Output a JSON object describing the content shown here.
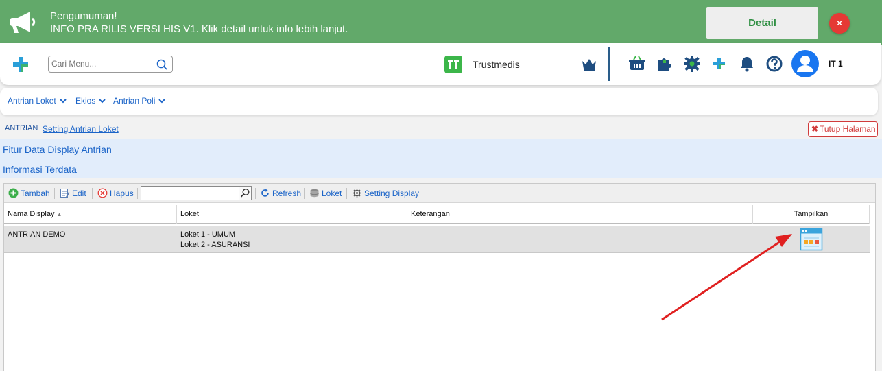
{
  "announcement": {
    "title": "Pengumuman!",
    "message": "INFO PRA RILIS VERSI HIS V1. Klik detail untuk info lebih lanjut.",
    "detail_label": "Detail",
    "close_label": "×",
    "icon": "megaphone-icon"
  },
  "header": {
    "search_placeholder": "Cari Menu...",
    "brand": "Trustmedis",
    "username": "IT 1",
    "icons": [
      "crown-icon",
      "basket-icon",
      "puzzle-icon",
      "gear-icon",
      "plus-icon",
      "bell-icon",
      "help-icon",
      "user-avatar-icon"
    ]
  },
  "menu": {
    "items": [
      {
        "label": "Antrian Loket"
      },
      {
        "label": "Ekios"
      },
      {
        "label": "Antrian Poli"
      }
    ]
  },
  "breadcrumb": {
    "root": "ANTRIAN",
    "active": "Setting Antrian Loket",
    "close_page": "Tutup Halaman"
  },
  "panels": {
    "line1": "Fitur Data Display Antrian",
    "line2": "Informasi Terdata"
  },
  "toolbar": {
    "add": "Tambah",
    "edit": "Edit",
    "delete": "Hapus",
    "search_value": "",
    "refresh": "Refresh",
    "loket": "Loket",
    "setting_display": "Setting Display"
  },
  "table": {
    "columns": [
      "Nama Display",
      "Loket",
      "Keterangan",
      "Tampilkan"
    ],
    "rows": [
      {
        "nama_display": "ANTRIAN DEMO",
        "loket_1": "Loket 1 - UMUM",
        "loket_2": "Loket 2 - ASURANSI",
        "keterangan": ""
      }
    ]
  },
  "colors": {
    "banner": "#62a96a",
    "link": "#1b64c8",
    "danger": "#e53935",
    "panel": "#e2edfb",
    "arrow": "#e02020"
  }
}
